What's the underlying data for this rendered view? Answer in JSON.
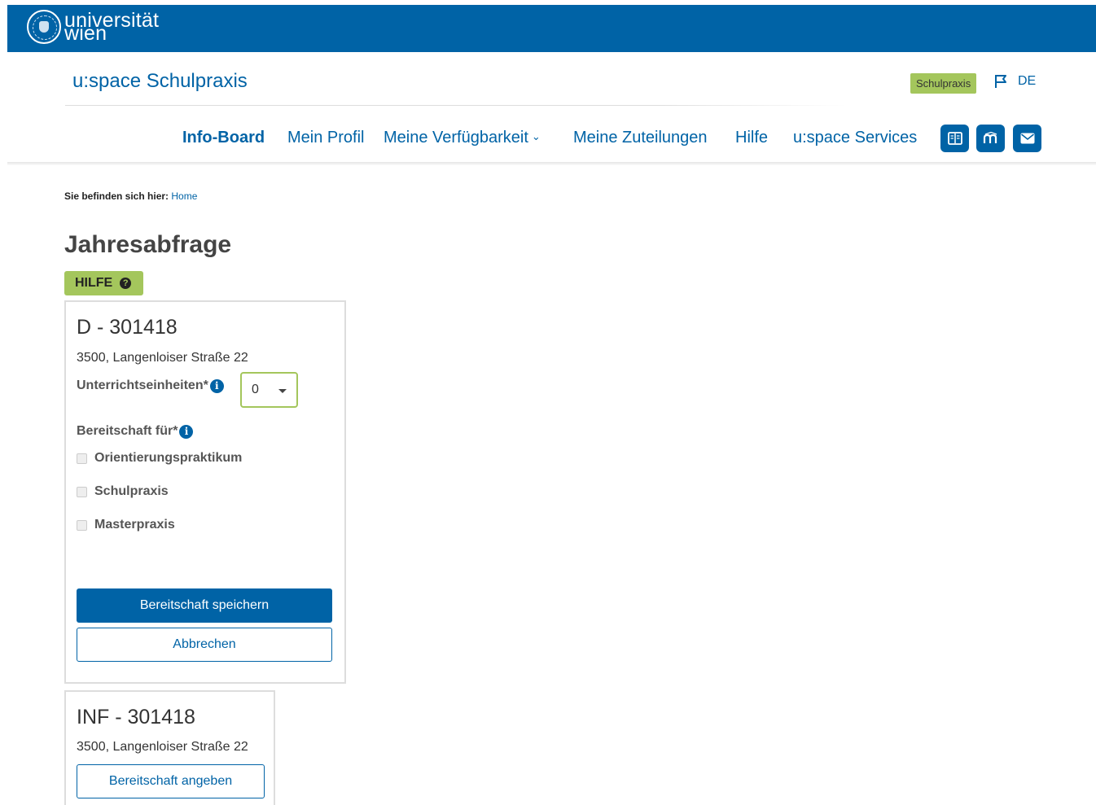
{
  "brand": {
    "logo_text_1": "universität",
    "logo_text_2": "wien"
  },
  "header": {
    "site_title": "u:space Schulpraxis",
    "badge": "Schulpraxis",
    "language": "DE"
  },
  "nav": {
    "items": [
      {
        "label": "Info-Board",
        "active": true
      },
      {
        "label": "Mein Profil"
      },
      {
        "label": "Meine Verfügbarkeit",
        "has_dropdown": true
      },
      {
        "label": "Meine Zuteilungen"
      },
      {
        "label": "Hilfe"
      },
      {
        "label": "u:space Services"
      }
    ],
    "icons": [
      "book-icon",
      "moodle-icon",
      "mail-icon"
    ]
  },
  "breadcrumb": {
    "prefix": "Sie befinden sich hier:",
    "home": "Home"
  },
  "page": {
    "title": "Jahresabfrage",
    "help_button": "HILFE"
  },
  "cards": [
    {
      "title": "D - 301418",
      "address": "3500, Langenloiser Straße 22",
      "units_label": "Unterrichtseinheiten*",
      "units_value": "0",
      "readiness_label": "Bereitschaft für*",
      "options": [
        "Orientierungspraktikum",
        "Schulpraxis",
        "Masterpraxis"
      ],
      "save_button": "Bereitschaft speichern",
      "cancel_button": "Abbrechen"
    },
    {
      "title": "INF - 301418",
      "address": "3500, Langenloiser Straße 22",
      "action_button": "Bereitschaft angeben"
    }
  ],
  "colors": {
    "brand_blue": "#0063a6",
    "accent_green": "#a4c65c"
  }
}
